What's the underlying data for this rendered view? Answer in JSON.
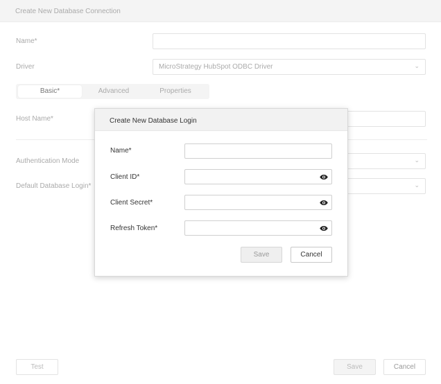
{
  "background": {
    "title": "Create New Database Connection",
    "name_label": "Name*",
    "driver_label": "Driver",
    "driver_value": "MicroStrategy HubSpot ODBC Driver",
    "tabs": [
      {
        "label": "Basic*"
      },
      {
        "label": "Advanced"
      },
      {
        "label": "Properties"
      }
    ],
    "host_label": "Host Name*",
    "auth_label": "Authentication Mode",
    "default_login_label": "Default Database Login*",
    "test_label": "Test",
    "save_label": "Save",
    "cancel_label": "Cancel"
  },
  "modal": {
    "title": "Create New Database Login",
    "fields": [
      {
        "label": "Name*",
        "value": ""
      },
      {
        "label": "Client ID*",
        "value": ""
      },
      {
        "label": "Client Secret*",
        "value": ""
      },
      {
        "label": "Refresh Token*",
        "value": ""
      }
    ],
    "save_label": "Save",
    "cancel_label": "Cancel",
    "icon": "eye-icon"
  }
}
